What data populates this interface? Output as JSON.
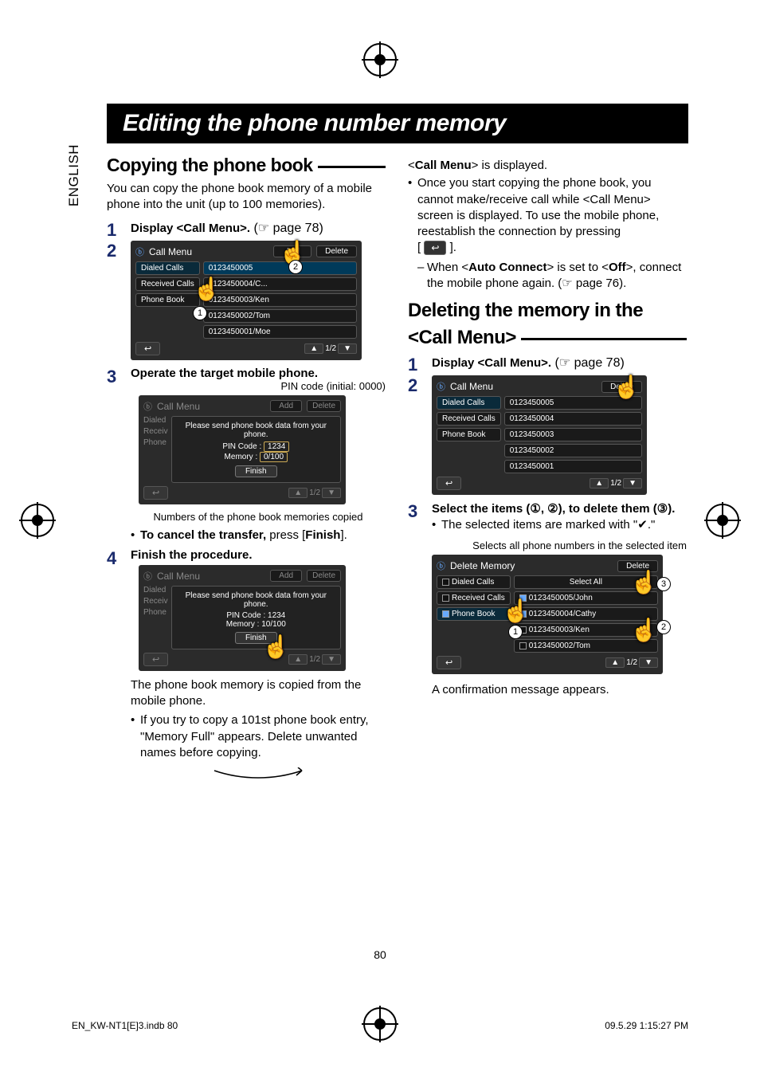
{
  "sidetab": "ENGLISH",
  "banner_title": "Editing the phone number memory",
  "copy": {
    "heading": "Copying the phone book",
    "intro": "You can copy the phone book memory of a mobile phone into the unit (up to 100 memories).",
    "step1_label": "Display <Call Menu>.",
    "step1_ref": "(☞ page 78)",
    "step3_label": "Operate the target mobile phone.",
    "pincode_caption": "PIN code (initial: 0000)",
    "memcount_caption": "Numbers of the phone book memories copied",
    "cancel_line_pre": "To cancel the transfer,",
    "cancel_line_post": " press [",
    "cancel_btn": "Finish",
    "cancel_line_end": "].",
    "step4_label": "Finish the procedure.",
    "body_after_panel": "The phone book memory is copied from the mobile phone.",
    "bullet_101": "If you try to copy a 101st phone book entry, \"Memory Full\" appears. Delete unwanted names before copying."
  },
  "panel1": {
    "title": "Call Menu",
    "add": "Add",
    "delete": "Delete",
    "left": [
      "Dialed Calls",
      "Received Calls",
      "Phone Book"
    ],
    "right": [
      "0123450005",
      "0123450004/C...",
      "0123450003/Ken",
      "0123450002/Tom",
      "0123450001/Moe"
    ],
    "page": "1/2"
  },
  "panel2": {
    "title": "Call Menu",
    "add": "Add",
    "delete": "Delete",
    "dialog_line": "Please send phone book data from your phone.",
    "pin_label": "PIN Code :",
    "pin_value": "1234",
    "mem_label": "Memory :",
    "mem_value": "0/100",
    "finish": "Finish",
    "left": [
      "Dialed",
      "Receiv",
      "Phone"
    ]
  },
  "panel3": {
    "title": "Call Menu",
    "add": "Add",
    "delete": "Delete",
    "dialog_line": "Please send phone book data from your phone.",
    "pin_line": "PIN Code : 1234",
    "mem_line": "Memory : 10/100",
    "finish": "Finish",
    "left": [
      "Dialed",
      "Receiv",
      "Phone"
    ]
  },
  "right_col": {
    "callmenu_displayed_pre": "<",
    "callmenu_displayed_label": "Call Menu",
    "callmenu_displayed_post": "> is displayed.",
    "bullet_copying": "Once you start copying the phone book, you cannot make/receive call while <Call Menu> screen is displayed. To use the mobile phone, reestablish the connection by pressing",
    "sub_autoconnect_pre": "When <",
    "sub_autoconnect_label": "Auto Connect",
    "sub_autoconnect_mid": "> is set to <",
    "sub_off": "Off",
    "sub_autoconnect_post": ">, connect the mobile phone again. (☞ page 76)."
  },
  "delete": {
    "heading_line1": "Deleting the memory in the",
    "heading_line2": "<Call Menu>",
    "step1_label": "Display <Call Menu>.",
    "step1_ref": "(☞ page 78)",
    "step3_label": "Select the items (①, ②), to delete them (③).",
    "step3_bullet": "The selected items are marked with \"✔.\"",
    "selects_all_caption": "Selects all phone numbers in the selected item",
    "confirm": "A confirmation message appears."
  },
  "panel4": {
    "title": "Call Menu",
    "delete": "Delete",
    "left": [
      "Dialed Calls",
      "Received Calls",
      "Phone Book"
    ],
    "right": [
      "0123450005",
      "0123450004",
      "0123450003",
      "0123450002",
      "0123450001"
    ],
    "page": "1/2"
  },
  "panel5": {
    "title": "Delete Memory",
    "delete": "Delete",
    "select_all": "Select All",
    "left": [
      "Dialed Calls",
      "Received Calls",
      "Phone Book"
    ],
    "right": [
      "0123450005/John",
      "0123450004/Cathy",
      "0123450003/Ken",
      "0123450002/Tom"
    ],
    "page": "1/2"
  },
  "page_number": "80",
  "footer_left": "EN_KW-NT1[E]3.indb   80",
  "footer_right": "09.5.29   1:15:27 PM"
}
